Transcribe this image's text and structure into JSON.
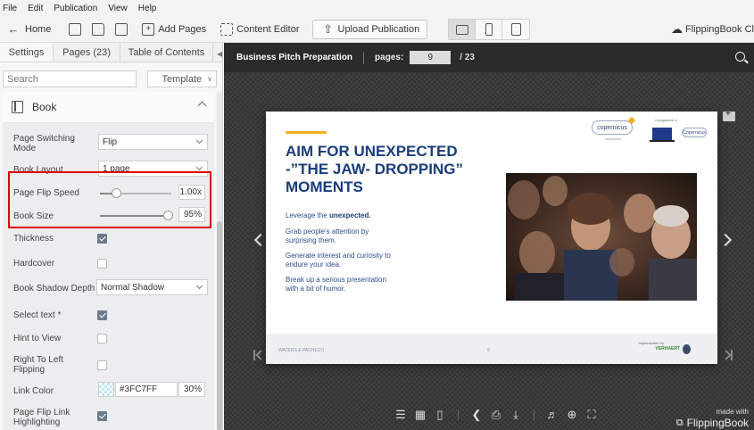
{
  "menu": [
    "File",
    "Edit",
    "Publication",
    "View",
    "Help"
  ],
  "toolbar": {
    "home": "Home",
    "add_pages": "Add Pages",
    "content_editor": "Content Editor",
    "upload": "Upload Publication",
    "brand": "FlippingBook Cl"
  },
  "left_panel": {
    "tabs": [
      "Settings",
      "Pages (23)",
      "Table of Contents"
    ],
    "search_placeholder": "Search",
    "template_label": "Template",
    "section_title": "Book",
    "settings": {
      "page_switching_mode": {
        "label": "Page Switching Mode",
        "value": "Flip"
      },
      "book_layout": {
        "label": "Book Layout",
        "value": "1 page"
      },
      "page_flip_speed": {
        "label": "Page Flip Speed",
        "value": "1.00x",
        "level": 0.2
      },
      "book_size": {
        "label": "Book Size",
        "value": "95%",
        "level": 0.95
      },
      "thickness": {
        "label": "Thickness",
        "checked": true
      },
      "hardcover": {
        "label": "Hardcover",
        "checked": false
      },
      "book_shadow_depth": {
        "label": "Book Shadow Depth",
        "value": "Normal Shadow"
      },
      "select_text": {
        "label": "Select text *",
        "checked": true
      },
      "hint_to_view": {
        "label": "Hint to View",
        "checked": false
      },
      "right_to_left": {
        "label": "Right To Left Flipping",
        "checked": false
      },
      "link_color": {
        "label": "Link Color",
        "hex": "#3FC7FF",
        "opacity": "30%"
      },
      "page_flip_link": {
        "label": "Page Flip Link Highlighting",
        "checked": true
      }
    }
  },
  "viewer": {
    "title": "Business Pitch Preparation",
    "pages_label": "pages:",
    "current_page": "9",
    "total_pages": "/ 23",
    "made_with": "made with",
    "brand": "FlippingBook"
  },
  "page_content": {
    "headline": "AIM FOR UNEXPECTED -”THE JAW- DROPPING” MOMENTS",
    "bullet1_prefix": "Leverage the ",
    "bullet1_bold": "unexpected.",
    "bullet2": "Grab people’s attention by surprising them.",
    "bullet3": "Generate interest and curiosity to endure your idea.",
    "bullet4": "Break up a serious presentation with a bit of humor.",
    "footer_left": "WATERS & PACHECO",
    "footer_num": "9",
    "footer_right": "Implemented by",
    "footer_logo": "VERHAERT",
    "logo1": "copernicus",
    "logo1_sub": "incubation",
    "logo2_label": "a programme of",
    "logo3": "Copernicus"
  }
}
